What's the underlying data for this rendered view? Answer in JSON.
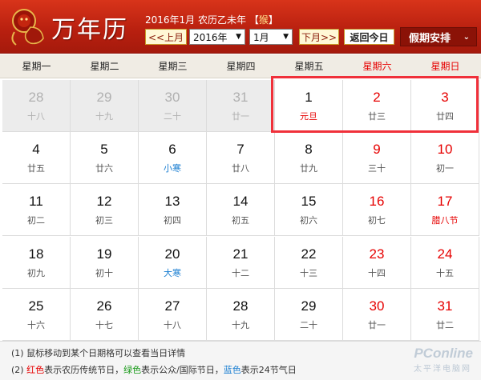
{
  "header": {
    "title": "万年历",
    "date_line_prefix": "2016年1月 农历乙未年",
    "zodiac_open": "【",
    "zodiac": "猴",
    "zodiac_close": "】",
    "prev_label": "<<上月",
    "year_value": "2016年",
    "month_value": "1月",
    "next_label": "下月>>",
    "today_label": "返回今日",
    "holiday_label": "假期安排",
    "holiday_arrow": "⌄",
    "brand_color": "#c0260f"
  },
  "weekdays": [
    "星期一",
    "星期二",
    "星期三",
    "星期四",
    "星期五",
    "星期六",
    "星期日"
  ],
  "weeks": [
    [
      {
        "day": "28",
        "lunar": "十八",
        "other": true
      },
      {
        "day": "29",
        "lunar": "十九",
        "other": true
      },
      {
        "day": "30",
        "lunar": "二十",
        "other": true
      },
      {
        "day": "31",
        "lunar": "廿一",
        "other": true
      },
      {
        "day": "1",
        "lunar": "元旦",
        "lunar_color": "red"
      },
      {
        "day": "2",
        "lunar": "廿三",
        "weekend": true
      },
      {
        "day": "3",
        "lunar": "廿四",
        "weekend": true
      }
    ],
    [
      {
        "day": "4",
        "lunar": "廿五"
      },
      {
        "day": "5",
        "lunar": "廿六"
      },
      {
        "day": "6",
        "lunar": "小寒",
        "lunar_color": "blue"
      },
      {
        "day": "7",
        "lunar": "廿八"
      },
      {
        "day": "8",
        "lunar": "廿九"
      },
      {
        "day": "9",
        "lunar": "三十",
        "weekend": true
      },
      {
        "day": "10",
        "lunar": "初一",
        "weekend": true
      }
    ],
    [
      {
        "day": "11",
        "lunar": "初二"
      },
      {
        "day": "12",
        "lunar": "初三"
      },
      {
        "day": "13",
        "lunar": "初四"
      },
      {
        "day": "14",
        "lunar": "初五"
      },
      {
        "day": "15",
        "lunar": "初六"
      },
      {
        "day": "16",
        "lunar": "初七",
        "weekend": true
      },
      {
        "day": "17",
        "lunar": "腊八节",
        "weekend": true,
        "lunar_color": "red"
      }
    ],
    [
      {
        "day": "18",
        "lunar": "初九"
      },
      {
        "day": "19",
        "lunar": "初十"
      },
      {
        "day": "20",
        "lunar": "大寒",
        "lunar_color": "blue"
      },
      {
        "day": "21",
        "lunar": "十二"
      },
      {
        "day": "22",
        "lunar": "十三"
      },
      {
        "day": "23",
        "lunar": "十四",
        "weekend": true
      },
      {
        "day": "24",
        "lunar": "十五",
        "weekend": true
      }
    ],
    [
      {
        "day": "25",
        "lunar": "十六"
      },
      {
        "day": "26",
        "lunar": "十七"
      },
      {
        "day": "27",
        "lunar": "十八"
      },
      {
        "day": "28",
        "lunar": "十九"
      },
      {
        "day": "29",
        "lunar": "二十"
      },
      {
        "day": "30",
        "lunar": "廿一",
        "weekend": true
      },
      {
        "day": "31",
        "lunar": "廿二",
        "weekend": true
      }
    ]
  ],
  "footer": {
    "line1": "(1) 鼠标移动到某个日期格可以查看当日详情",
    "line2_prefix": "(2) ",
    "red_word": "红色",
    "red_desc": "表示农历传统节日，",
    "green_word": "绿色",
    "green_desc": "表示公众/国际节日，",
    "blue_word": "蓝色",
    "blue_desc": "表示24节气日"
  },
  "watermark": {
    "brand": "PConline",
    "sub": "太平洋电脑网"
  }
}
